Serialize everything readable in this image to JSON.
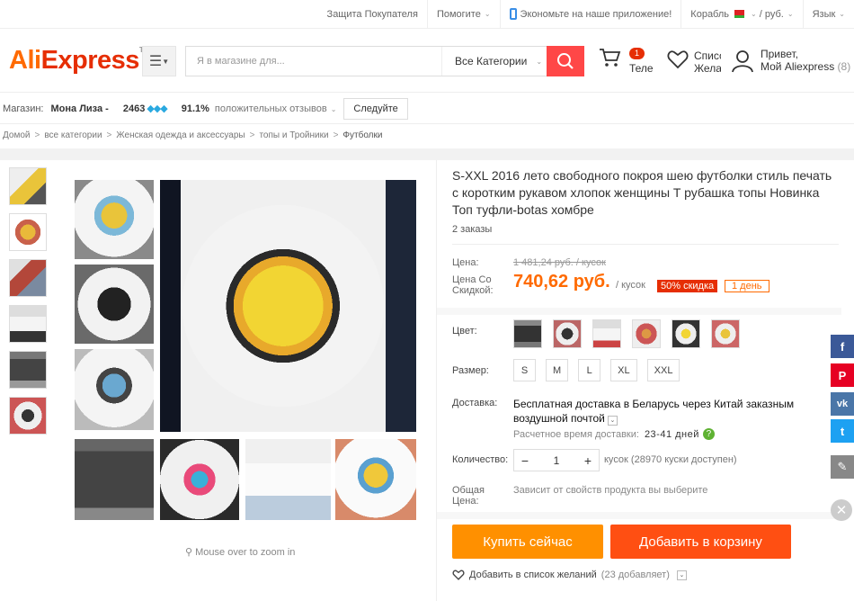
{
  "topbar": {
    "buyer_protection": "Защита Покупателя",
    "help": "Помогите",
    "app": "Экономьте на наше приложение!",
    "ship_to": "Корабль",
    "currency": "руб.",
    "language": "Язык"
  },
  "header": {
    "logo_left": "Ali",
    "logo_right": "Express",
    "logo_tm": "TM",
    "search_placeholder": "Я в магазине для...",
    "category": "Все Категории",
    "cart_count": "1",
    "cart_label": "Теле",
    "wishlist_line1": "Списо",
    "wishlist_line2": "Желан",
    "greeting": "Привет,",
    "my_account": "Мой Aliexpress",
    "account_count": "(8)"
  },
  "store": {
    "label": "Магазин:",
    "name": "Мона Лиза -",
    "score": "2463",
    "positive_pct": "91.1%",
    "positive_label": "положительных отзывов",
    "follow": "Следуйте"
  },
  "breadcrumb": [
    "Домой",
    "все категории",
    "Женская одежда и аксессуары",
    "топы и Тройники",
    "Футболки"
  ],
  "gallery": {
    "zoom_hint": "Mouse over to zoom in"
  },
  "product": {
    "title": "S-XXL 2016 лето свободного покроя шею футболки стиль печать с коротким рукавом хлопок женщины T рубашка топы Новинка Топ туфли-botas хомбре",
    "orders": "2 заказы",
    "price_label": "Цена:",
    "old_price": "1 481,24 руб. / кусок",
    "discount_label_1": "Цена Со",
    "discount_label_2": "Скидкой:",
    "new_price": "740,62 руб.",
    "unit": "/ кусок",
    "discount": "50% скидка",
    "days_left": "1 день",
    "color_label": "Цвет:",
    "size_label": "Размер:",
    "sizes": [
      "S",
      "M",
      "L",
      "XL",
      "XXL"
    ],
    "shipping_label": "Доставка:",
    "shipping_text": "Бесплатная доставка в Беларусь через Китай заказным воздушной почтой",
    "delivery_time_label": "Расчетное время доставки:",
    "delivery_time": "23-41 дней",
    "qty_label": "Количество:",
    "qty_value": "1",
    "stock": "кусок (28970 куски доступен)",
    "total_label_1": "Общая",
    "total_label_2": "Цена:",
    "total_value": "Зависит от свойств продукта вы выберите",
    "buy_now": "Купить сейчас",
    "add_to_cart": "Добавить в корзину",
    "add_wishlist": "Добавить в список желаний",
    "wishlist_count": "(23 добавляет)"
  },
  "social": [
    "f",
    "P",
    "vk",
    "t"
  ],
  "colors": {
    "accent": "#ff4747",
    "price": "#ff6a00",
    "buy": "#ff9000",
    "cart": "#ff4f12"
  }
}
